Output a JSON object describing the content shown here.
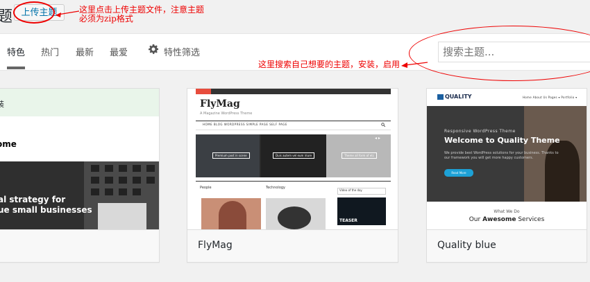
{
  "header": {
    "title_fragment": "题",
    "upload_button": "上传主题"
  },
  "annotations": {
    "upload_note_line1": "这里点击上传主题文件，注意主题",
    "upload_note_line2": "必须为zip格式",
    "search_note": "这里搜索自己想要的主题，安装，启用"
  },
  "filter": {
    "tabs": [
      {
        "label": "特色",
        "active": true
      },
      {
        "label": "热门",
        "active": false
      },
      {
        "label": "最新",
        "active": false
      },
      {
        "label": "最爱",
        "active": false
      }
    ],
    "feature_filter_label": "特性筛选",
    "search_placeholder": "搜索主题..."
  },
  "themes": [
    {
      "name": "",
      "preview": {
        "top_text": "装",
        "bold_text": "ome",
        "hero_line1": "al strategy for",
        "hero_line2": "ue small businesses"
      }
    },
    {
      "name": "FlyMag",
      "preview": {
        "logo": "FlyMag",
        "tagline": "A Magazine WordPress Theme",
        "nav": "HOME  BLOG  WORDPRESS  SIMPLE PAGE  SELF PAGE",
        "slide_labels": [
          "Premium post in scene",
          "Duis autem vel eum iriure",
          "Theme all form of etc"
        ],
        "cat1": "People",
        "cat2": "Technology",
        "side_label": "Video of the day",
        "teaser": "TEASER"
      }
    },
    {
      "name": "Quality blue",
      "preview": {
        "logo": "QUALITY",
        "nav": "Home   About Us   Pages ▾   Portfolio ▾",
        "hero_sub": "Responsive WordPress Theme",
        "hero_title": "Welcome to Quality Theme",
        "hero_desc": "We provide best WordPress solutions for your business. Thanks to our framework you will get more happy customers.",
        "button": "Read More",
        "what_we_do": "What We Do",
        "services_prefix": "Our ",
        "services_bold": "Awesome",
        "services_suffix": " Services"
      }
    }
  ],
  "colors": {
    "accent": "#0073aa",
    "annotation": "#ee0000",
    "quality_button": "#1da1d6"
  }
}
